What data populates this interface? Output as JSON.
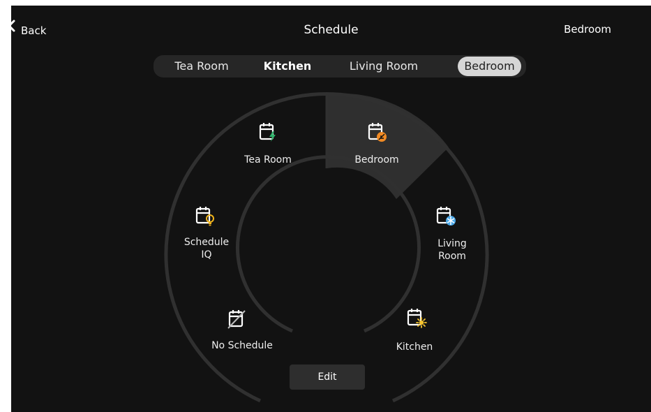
{
  "header": {
    "back_label": "Back",
    "title": "Schedule",
    "current_room": "Bedroom"
  },
  "tabs": [
    {
      "label": "Tea Room",
      "selected": false
    },
    {
      "label": "Kitchen",
      "selected": false
    },
    {
      "label": "Living Room",
      "selected": false
    },
    {
      "label": "Bedroom",
      "selected": true
    }
  ],
  "wheel": {
    "segments": [
      {
        "label": "Tea Room",
        "icon": "calendar-bolt-icon",
        "accent": "#2fb36b",
        "selected": false
      },
      {
        "label": "Bedroom",
        "icon": "calendar-leaf-icon",
        "accent": "#f08a24",
        "selected": true
      },
      {
        "label": "Living\nRoom",
        "icon": "calendar-snowflake-icon",
        "accent": "#4aa8e8",
        "selected": false
      },
      {
        "label": "Kitchen",
        "icon": "calendar-sun-icon",
        "accent": "#f2c12e",
        "selected": false
      },
      {
        "label": "No Schedule",
        "icon": "calendar-off-icon",
        "accent": "#bbbbbb",
        "selected": false
      },
      {
        "label": "Schedule\nIQ",
        "icon": "calendar-bulb-icon",
        "accent": "#f2b51c",
        "selected": false
      }
    ],
    "edit_label": "Edit"
  },
  "colors": {
    "background": "#121212",
    "ring": "#303030",
    "selected_segment": "#2f2f2f",
    "tab_bar": "#262626",
    "tab_selected": "#d6d6d6"
  }
}
